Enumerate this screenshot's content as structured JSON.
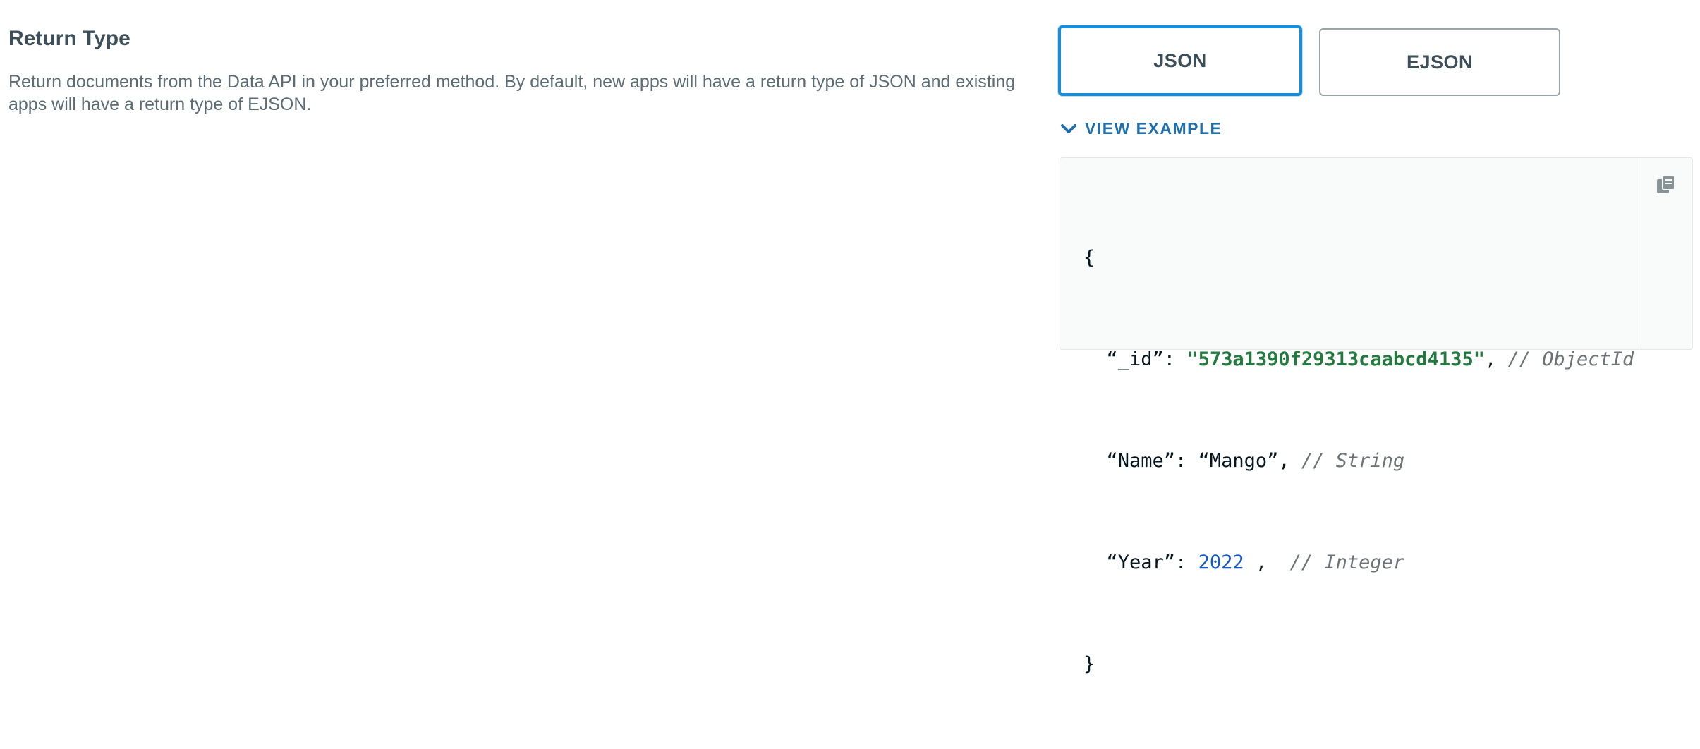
{
  "return_type": {
    "title": "Return Type",
    "description": "Return documents from the Data API in your preferred method. By default, new apps will have a return type of JSON and existing apps will have a return type of EJSON."
  },
  "toggle": {
    "options": [
      {
        "label": "JSON",
        "selected": true
      },
      {
        "label": "EJSON",
        "selected": false
      }
    ]
  },
  "view_example": {
    "label": "VIEW EXAMPLE",
    "icon": "chevron-down-icon"
  },
  "code_example": {
    "open_brace": "{",
    "close_brace": "}",
    "lines": [
      {
        "key": "“_id”: ",
        "value": "\"573a1390f29313caabcd4135\"",
        "sep": ", ",
        "comment": "// ObjectId"
      },
      {
        "key": "“Name”: ",
        "value": "“Mango”",
        "sep": ", ",
        "comment": "// String"
      },
      {
        "key": "“Year”: ",
        "value": "2022",
        "sep": " ,  ",
        "comment": "// Integer"
      }
    ],
    "copy_icon": "copy-icon"
  },
  "colors": {
    "accent_blue": "#1a8ed4",
    "link_blue": "#1f6fad",
    "string_green": "#237a3e",
    "number_blue": "#1558c7"
  }
}
